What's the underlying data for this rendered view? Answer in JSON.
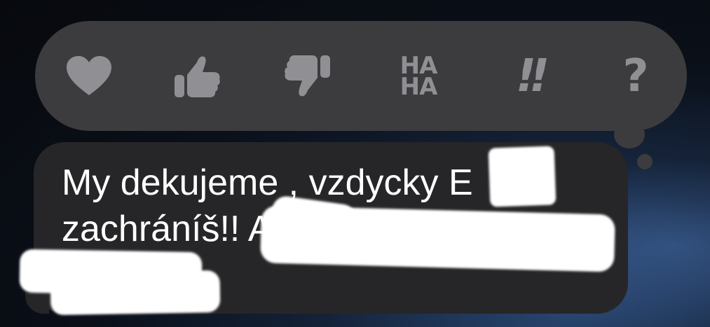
{
  "tapback_bar": {
    "reactions": [
      {
        "name": "heart",
        "icon": "heart-icon"
      },
      {
        "name": "thumbs-up",
        "icon": "thumbs-up-icon"
      },
      {
        "name": "thumbs-down",
        "icon": "thumbs-down-icon"
      },
      {
        "name": "haha",
        "icon": "haha-icon",
        "line1": "HA",
        "line2": "HA"
      },
      {
        "name": "emphasize",
        "icon": "exclamation-icon",
        "text": "!!"
      },
      {
        "name": "question",
        "icon": "question-icon",
        "text": "?"
      }
    ]
  },
  "message": {
    "line1": "My dekujeme , vzdycky E",
    "line2": "zachráníš!! A",
    "line3": "?"
  },
  "colors": {
    "tapback_bg": "#3c3c3e",
    "reaction_icon": "#8f8f94",
    "bubble_bg": "#262628",
    "text": "#ffffff",
    "redaction": "#ffffff"
  }
}
